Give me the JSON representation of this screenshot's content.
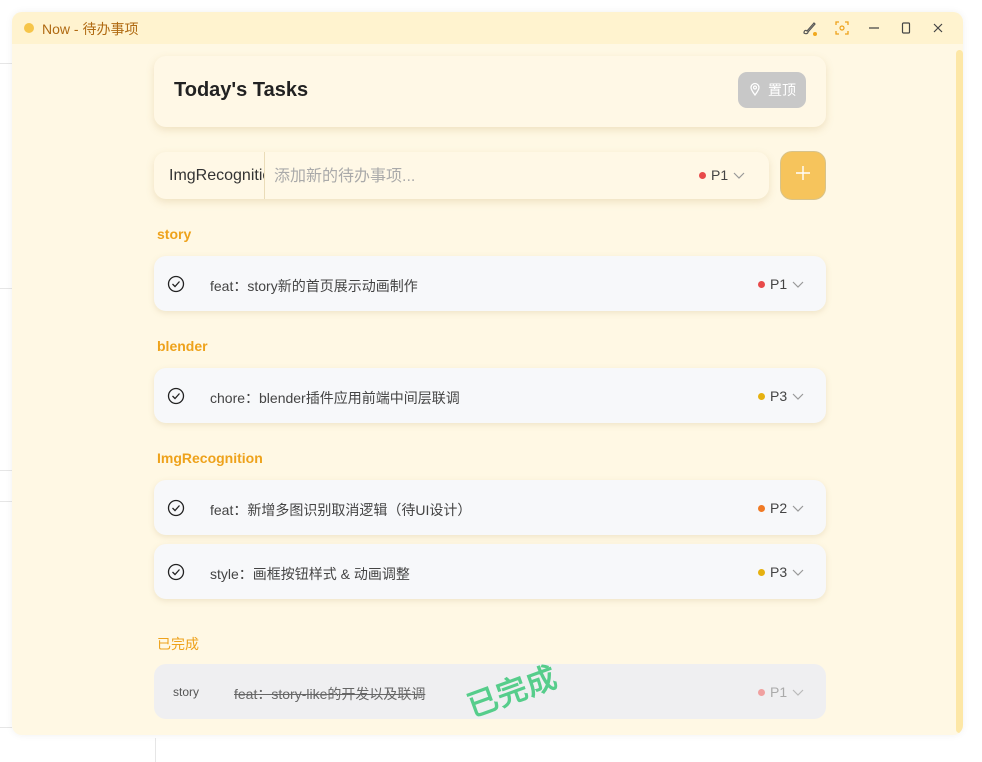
{
  "window": {
    "title": "Now - 待办事项"
  },
  "header": {
    "title": "Today's Tasks",
    "pin_label": "置顶"
  },
  "input_bar": {
    "category_value": "ImgRecognition",
    "task_placeholder": "添加新的待办事项...",
    "priority": "P1",
    "priority_color": "#e84a4a"
  },
  "groups": [
    {
      "label": "story",
      "tasks": [
        {
          "text": "feat：story新的首页展示动画制作",
          "priority": "P1",
          "priority_color": "#e84a4a"
        }
      ]
    },
    {
      "label": "blender",
      "tasks": [
        {
          "text": "chore：blender插件应用前端中间层联调",
          "priority": "P3",
          "priority_color": "#e6b110"
        }
      ]
    },
    {
      "label": "ImgRecognition",
      "tasks": [
        {
          "text": "feat：新增多图识别取消逻辑（待UI设计）",
          "priority": "P2",
          "priority_color": "#f07a25"
        },
        {
          "text": "style：画框按钮样式 & 动画调整",
          "priority": "P3",
          "priority_color": "#e6b110"
        }
      ]
    }
  ],
  "completed": {
    "label": "已完成",
    "stamp": "已完成",
    "tasks": [
      {
        "category": "story",
        "text": "feat：story-like的开发以及联调",
        "priority": "P1",
        "priority_color": "#f0a0a0"
      }
    ]
  },
  "colors": {
    "accent": "#eea21b",
    "window_bg": "#fff8e4",
    "add_button": "#f6c45c"
  }
}
